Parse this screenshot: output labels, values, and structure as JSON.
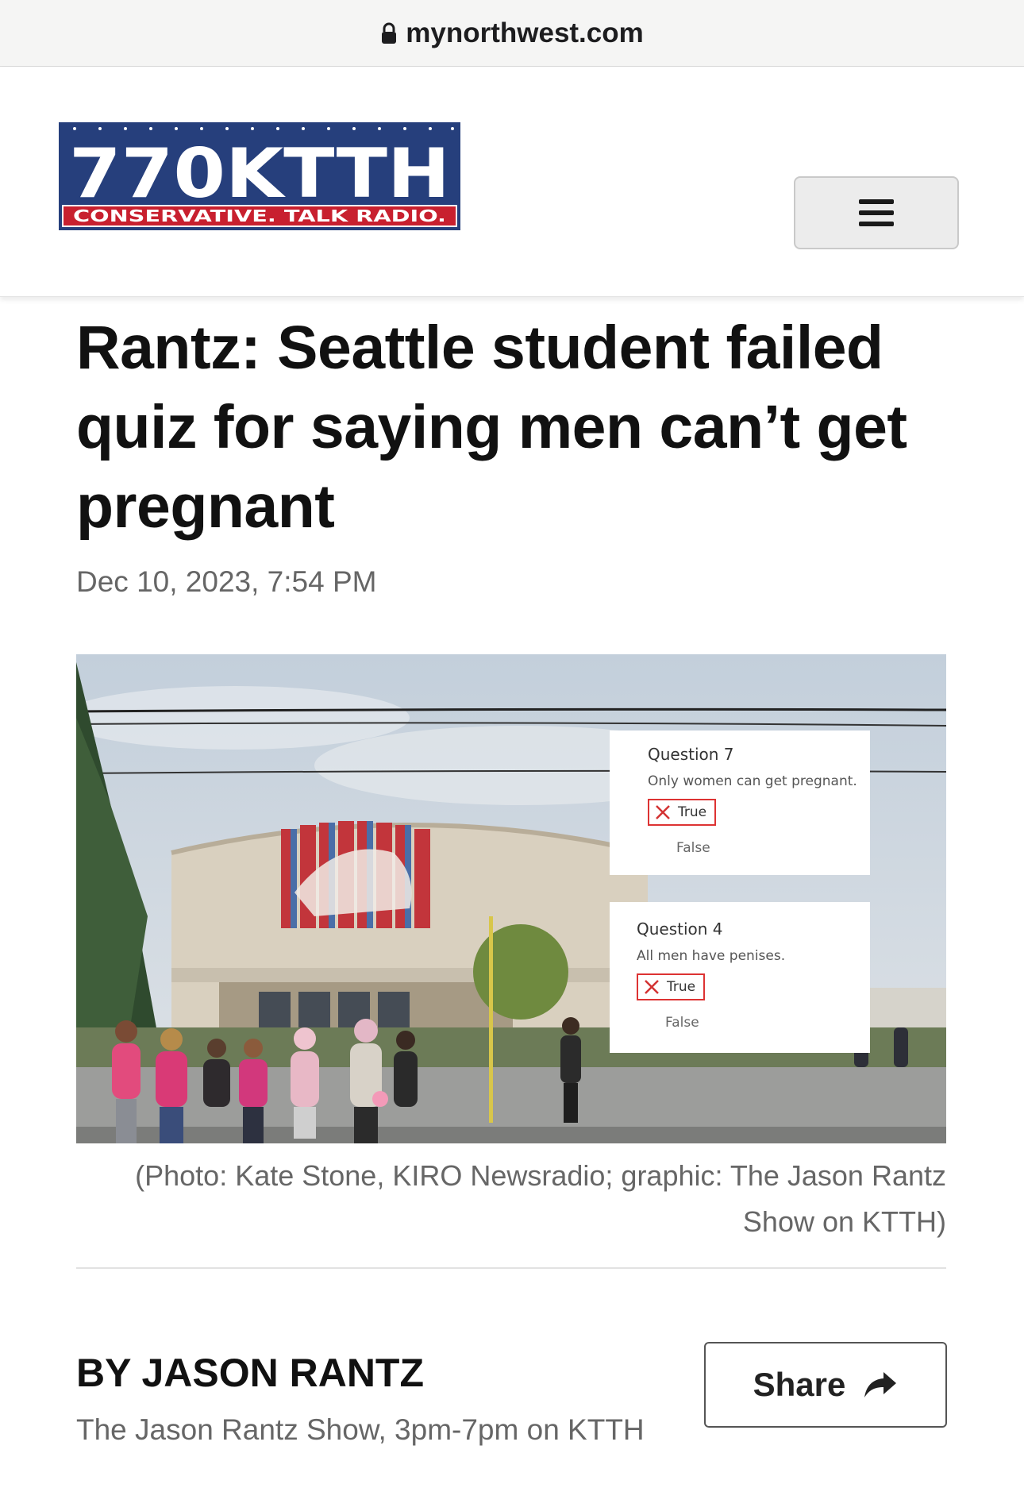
{
  "browser": {
    "url": "mynorthwest.com"
  },
  "header": {
    "logo_text": "770KTTH",
    "logo_tagline": "CONSERVATIVE. TALK RADIO."
  },
  "article": {
    "headline": "Rantz: Seattle student failed quiz for saying men can’t get pregnant",
    "date": "Dec 10, 2023, 7:54 PM",
    "caption": "(Photo: Kate Stone, KIRO Newsradio; graphic: The Jason Rantz Show on KTTH)",
    "byline": "BY JASON RANTZ",
    "show": "The Jason Rantz Show, 3pm-7pm on KTTH",
    "share_label": "Share"
  },
  "photo": {
    "quiz": [
      {
        "title": "Question 7",
        "text": "Only women can get pregnant.",
        "selected": "True",
        "other": "False"
      },
      {
        "title": "Question 4",
        "text": "All men have penises.",
        "selected": "True",
        "other": "False"
      }
    ]
  },
  "colors": {
    "logo_blue": "#263f7c",
    "logo_red": "#c8202f",
    "wrong_red": "#d33333"
  }
}
